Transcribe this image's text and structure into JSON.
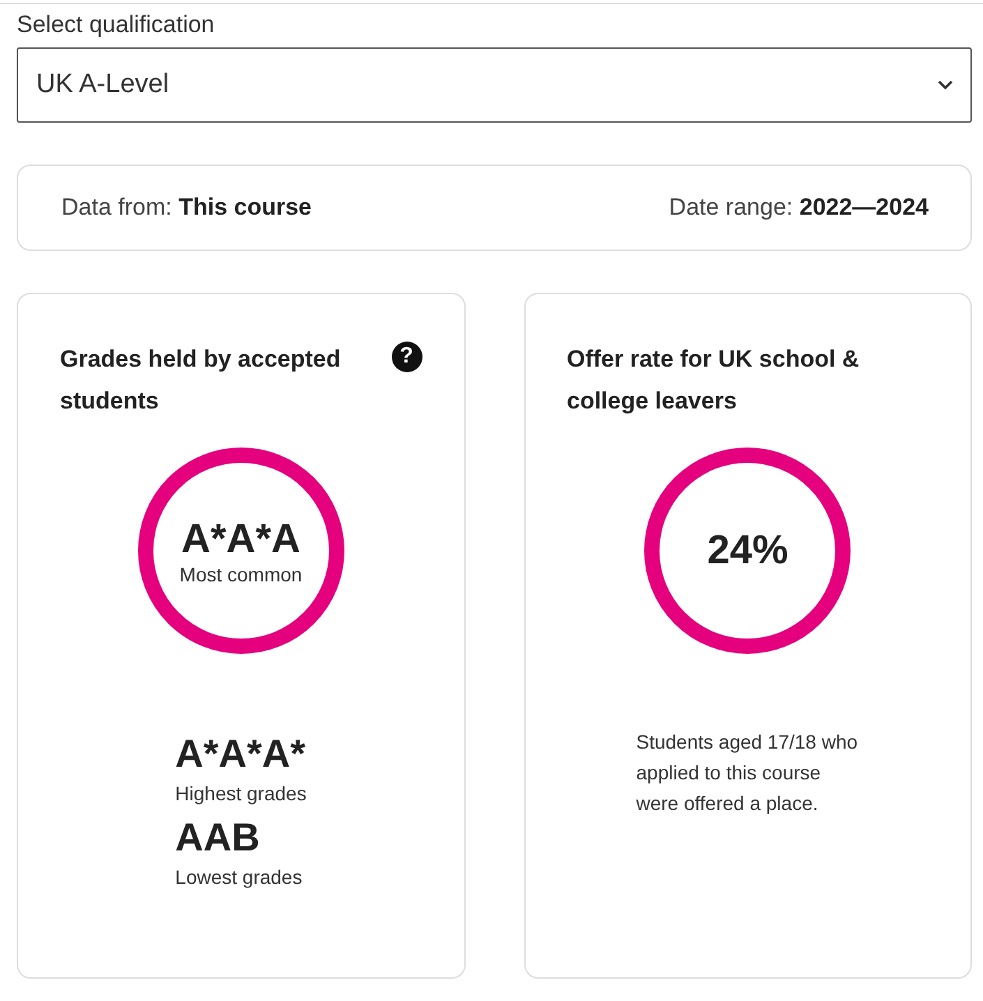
{
  "qualification": {
    "label": "Select qualification",
    "value": "UK A-Level"
  },
  "info": {
    "data_from_label": "Data from:",
    "data_from": "This course",
    "date_range_label": "Date range:",
    "date_range": "2022—2024"
  },
  "cards": [
    {
      "kind": "grades",
      "title": "Grades held by accepted students",
      "help": "?",
      "ring_value": "A*A*A",
      "ring_caption": "Most common",
      "stats": [
        {
          "value": "A*A*A*",
          "label": "Highest grades"
        },
        {
          "value": "AAB",
          "label": "Lowest grades"
        }
      ]
    },
    {
      "kind": "offer",
      "title": "Offer rate for UK school & college leavers",
      "ring_value": "24%",
      "description": "Students aged 17/18 who applied to this course were offered a place."
    }
  ]
}
